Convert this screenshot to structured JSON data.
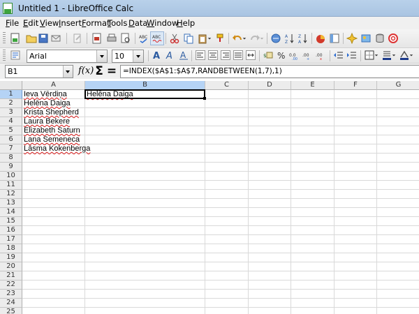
{
  "window": {
    "title": "Untitled 1 - LibreOffice Calc"
  },
  "menu": [
    "File",
    "Edit",
    "View",
    "Insert",
    "Format",
    "Tools",
    "Data",
    "Window",
    "Help"
  ],
  "formatting": {
    "font_name": "Arial",
    "font_size": "10"
  },
  "formula_bar": {
    "name_box": "B1",
    "fx_label": "f(x)",
    "sum_label": "Σ",
    "equals_label": "=",
    "formula": "=INDEX($A$1:$A$7,RANDBETWEEN(1,7),1)"
  },
  "sheet": {
    "columns": [
      "A",
      "B",
      "C",
      "D",
      "E",
      "F",
      "G"
    ],
    "active_column": "B",
    "active_row": "1",
    "rows": [
      "1",
      "2",
      "3",
      "4",
      "5",
      "6",
      "7",
      "8",
      "9",
      "10",
      "11",
      "12",
      "13",
      "14",
      "15",
      "16",
      "17",
      "18",
      "19",
      "20",
      "21",
      "22",
      "23",
      "24",
      "25"
    ],
    "column_a": [
      "Ieva Vērdiņa",
      "Helēna Daiga",
      "Krista Shepherd",
      "Laura Bekere",
      "Elizabeth Saturn",
      "Lana Semeneca",
      "Lāsma Kokenberga"
    ],
    "b1_value": "Helēna Daiga"
  },
  "icons": {
    "toolbar1": [
      "new-document-icon",
      "open-icon",
      "save-icon",
      "email-icon",
      "edit-file-icon",
      "export-pdf-icon",
      "print-icon",
      "print-preview-icon",
      "spellcheck-icon",
      "autospellcheck-icon",
      "cut-icon",
      "copy-icon",
      "paste-icon",
      "clone-formatting-icon",
      "undo-icon",
      "redo-icon",
      "hyperlink-icon",
      "sort-ascending-icon",
      "sort-descending-icon",
      "chart-icon",
      "pivot-icon",
      "navigator-icon",
      "gallery-icon",
      "help-icon"
    ],
    "toolbar2": [
      "styles-icon",
      "bold-icon",
      "italic-icon",
      "underline-icon",
      "align-left-icon",
      "align-center-icon",
      "align-right-icon",
      "justify-icon",
      "merge-icon",
      "currency-icon",
      "percent-icon",
      "number-format-icon",
      "add-decimal-icon",
      "delete-decimal-icon",
      "decrease-indent-icon",
      "increase-indent-icon",
      "borders-icon",
      "background-color-icon",
      "font-color-icon"
    ]
  },
  "colors": {
    "selection_header": "#b5d3f5",
    "spell_error": "#e02020"
  }
}
